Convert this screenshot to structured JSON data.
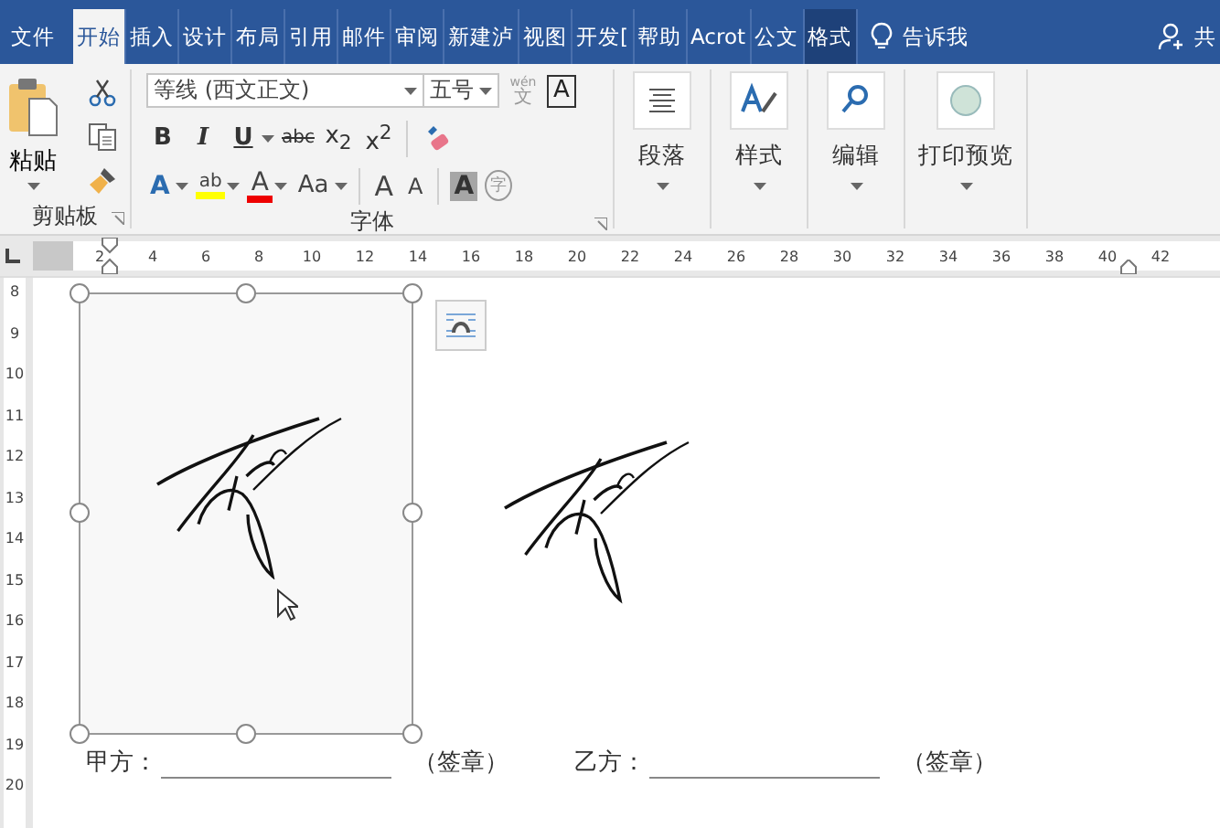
{
  "tabs": [
    {
      "label": "文件",
      "selected": false,
      "kind": "normal"
    },
    {
      "label": "开始",
      "selected": true,
      "kind": "normal"
    },
    {
      "label": "插入",
      "selected": false,
      "kind": "normal"
    },
    {
      "label": "设计",
      "selected": false,
      "kind": "normal"
    },
    {
      "label": "布局",
      "selected": false,
      "kind": "normal"
    },
    {
      "label": "引用",
      "selected": false,
      "kind": "normal"
    },
    {
      "label": "邮件",
      "selected": false,
      "kind": "normal"
    },
    {
      "label": "审阅",
      "selected": false,
      "kind": "normal"
    },
    {
      "label": "新建泸",
      "selected": false,
      "kind": "normal"
    },
    {
      "label": "视图",
      "selected": false,
      "kind": "normal"
    },
    {
      "label": "开发[",
      "selected": false,
      "kind": "normal"
    },
    {
      "label": "帮助",
      "selected": false,
      "kind": "normal"
    },
    {
      "label": "Acrot",
      "selected": false,
      "kind": "normal"
    },
    {
      "label": "公文",
      "selected": false,
      "kind": "normal"
    },
    {
      "label": "格式",
      "selected": false,
      "kind": "contextual"
    }
  ],
  "tell_me": "告诉我",
  "share": "共",
  "clipboard": {
    "paste": "粘贴",
    "label": "剪贴板"
  },
  "font": {
    "font_name": "等线 (西文正文)",
    "font_size": "五号",
    "phonetic_top": "wén",
    "phonetic_bottom": "文",
    "border_char": "A",
    "row1": [
      "B",
      "I",
      "U",
      "abc",
      "x$_{2}$",
      "x$^{2}$"
    ],
    "row2": [
      {
        "kind": "effect",
        "text": "A"
      },
      {
        "kind": "highlight",
        "text": "ab"
      },
      {
        "kind": "color",
        "text": "A"
      },
      {
        "kind": "case",
        "text": "Aa"
      },
      {
        "kind": "grow",
        "text": "A"
      },
      {
        "kind": "shrink",
        "text": "A"
      },
      {
        "kind": "shade",
        "text": "A"
      },
      {
        "kind": "enclose",
        "text": "字"
      }
    ],
    "label": "字体"
  },
  "groups": [
    {
      "label": "段落",
      "kind": "paragraph"
    },
    {
      "label": "样式",
      "kind": "styles"
    },
    {
      "label": "编辑",
      "kind": "editing"
    },
    {
      "label": "打印预览",
      "kind": "preview"
    }
  ],
  "ruler": [
    "2",
    "4",
    "6",
    "8",
    "10",
    "12",
    "14",
    "16",
    "18",
    "20",
    "22",
    "24",
    "26",
    "28",
    "30",
    "32",
    "34",
    "36",
    "38",
    "40",
    "42"
  ],
  "vruler": [
    "8",
    "9",
    "10",
    "11",
    "12",
    "13",
    "14",
    "15",
    "16",
    "17",
    "18",
    "19",
    "20"
  ],
  "signature_line": {
    "party_a": "甲方：",
    "seal_a": "（签章）",
    "party_b": "乙方：",
    "seal_b": "（签章）"
  }
}
